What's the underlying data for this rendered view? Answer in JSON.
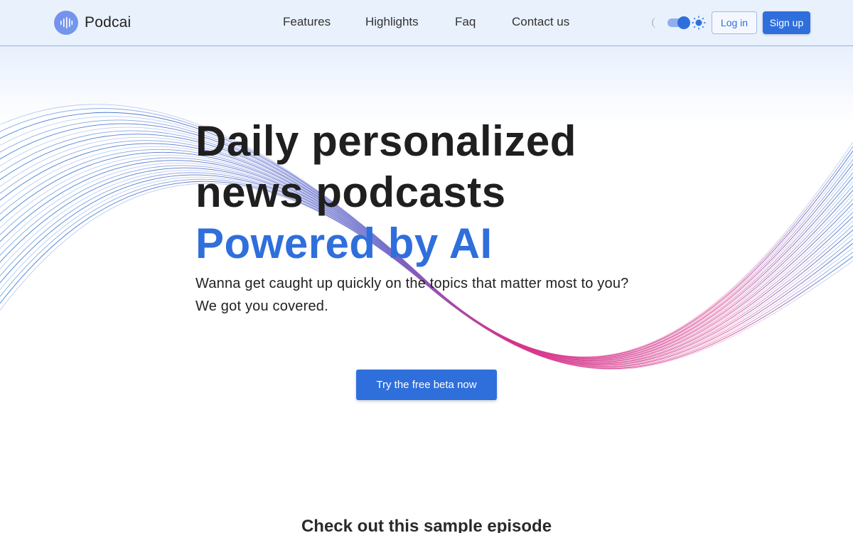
{
  "header": {
    "brand": "Podcai",
    "nav": [
      {
        "label": "Features"
      },
      {
        "label": "Highlights"
      },
      {
        "label": "Faq"
      },
      {
        "label": "Contact us"
      }
    ],
    "theme_toggle": {
      "state": "light"
    },
    "login_label": "Log in",
    "signup_label": "Sign up"
  },
  "hero": {
    "title_line1": "Daily personalized",
    "title_line2": "news podcasts",
    "title_accent": "Powered by AI",
    "subtitle_line1": "Wanna get caught up quickly on the topics that matter most to you?",
    "subtitle_line2": "We got you covered.",
    "cta_label": "Try the free beta now"
  },
  "sample": {
    "heading": "Check out this sample episode"
  },
  "colors": {
    "accent": "#2f6fdc",
    "header_bg": "#e9f1fd",
    "wave_start": "#3a7bd5",
    "wave_end": "#d6338a"
  }
}
